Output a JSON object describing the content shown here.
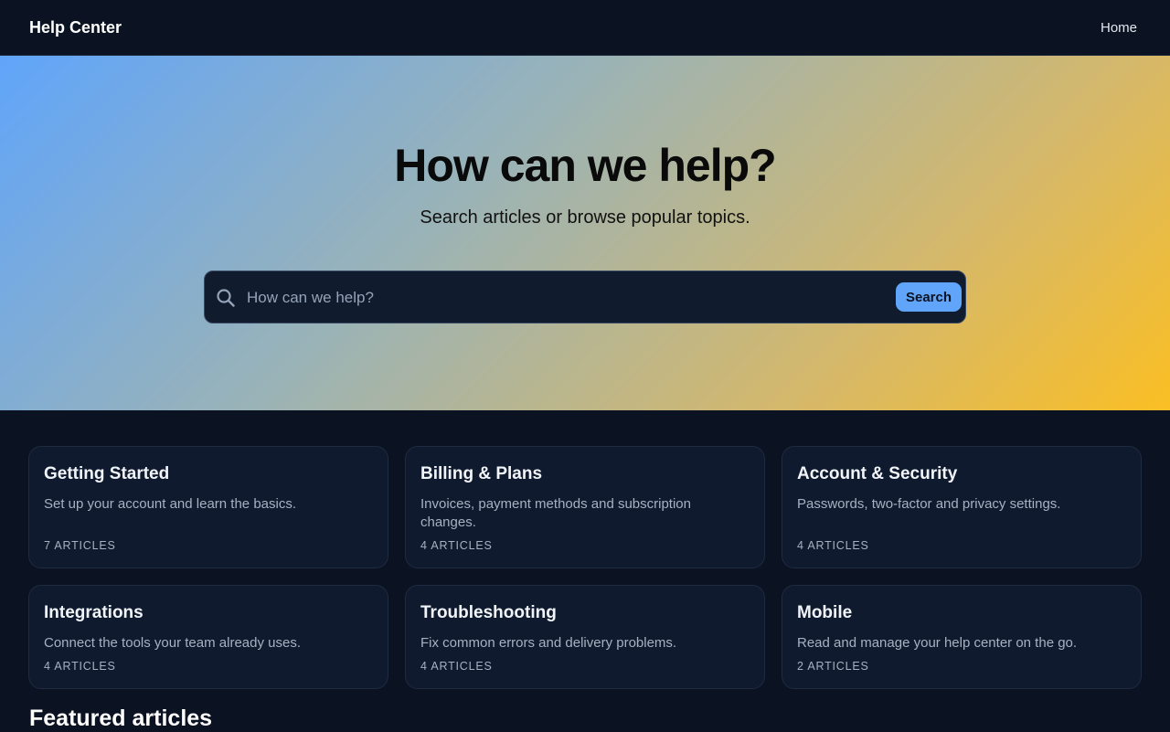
{
  "header": {
    "brand": "Help Center",
    "nav_home": "Home"
  },
  "hero": {
    "title": "How can we help?",
    "subtitle": "Search articles or browse popular topics.",
    "search": {
      "placeholder": "How can we help?",
      "value": "",
      "button_label": "Search",
      "icon": "search-icon"
    }
  },
  "categories": [
    {
      "title": "Getting Started",
      "description": "Set up your account and learn the basics.",
      "count": "7 ARTICLES"
    },
    {
      "title": "Billing & Plans",
      "description": "Invoices, payment methods and subscription changes.",
      "count": "4 ARTICLES"
    },
    {
      "title": "Account & Security",
      "description": "Passwords, two-factor and privacy settings.",
      "count": "4 ARTICLES"
    },
    {
      "title": "Integrations",
      "description": "Connect the tools your team already uses.",
      "count": "4 ARTICLES"
    },
    {
      "title": "Troubleshooting",
      "description": "Fix common errors and delivery problems.",
      "count": "4 ARTICLES"
    },
    {
      "title": "Mobile",
      "description": "Read and manage your help center on the go.",
      "count": "2 ARTICLES"
    }
  ],
  "featured": {
    "heading": "Featured articles"
  },
  "colors": {
    "background": "#0b1221",
    "card": "#101a2e",
    "accent": "#60a5fa",
    "hero_gradient_start": "#60a5fa",
    "hero_gradient_end": "#fbbf24"
  }
}
